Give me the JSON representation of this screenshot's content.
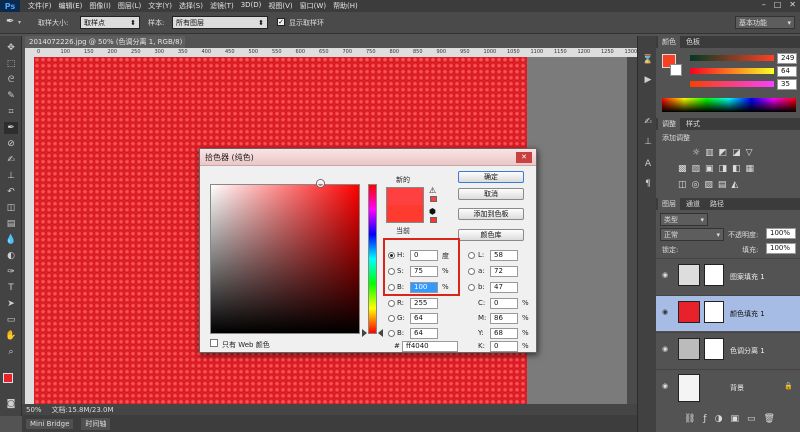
{
  "app": {
    "logo": "Ps"
  },
  "menubar": {
    "items": [
      "文件(F)",
      "编辑(E)",
      "图像(I)",
      "图层(L)",
      "文字(Y)",
      "选择(S)",
      "滤镜(T)",
      "3D(D)",
      "视图(V)",
      "窗口(W)",
      "帮助(H)"
    ],
    "window_controls": [
      "–",
      "□",
      "✕"
    ]
  },
  "options_bar": {
    "sample_size_label": "取样大小:",
    "sample_size_value": "取样点",
    "sample_label": "样本:",
    "sample_value": "所有图层",
    "show_ring_label": "显示取样环",
    "workspace_value": "基本功能"
  },
  "document": {
    "tab_title": "2014072226.jpg @ 50% (色调分离 1, RGB/8) * ×",
    "ruler_ticks": [
      "0",
      "100",
      "150",
      "200",
      "250",
      "300",
      "350",
      "400",
      "450",
      "500",
      "550",
      "600",
      "650",
      "700",
      "750",
      "800",
      "850",
      "900",
      "950",
      "1000",
      "1050",
      "1100",
      "1150",
      "1200",
      "1250",
      "1300"
    ]
  },
  "status_bar": {
    "zoom": "50%",
    "doc_info": "文档:15.8M/23.0M"
  },
  "bottom_tabs": [
    "Mini Bridge",
    "时间轴"
  ],
  "color_panel": {
    "tabs": [
      "颜色",
      "色板"
    ],
    "r_value": "249",
    "g_value": "64",
    "b_value": "35"
  },
  "adjustments_panel": {
    "tabs": [
      "调整",
      "样式"
    ],
    "hint": "添加调整"
  },
  "layers_panel": {
    "tabs": [
      "图层",
      "通道",
      "路径"
    ],
    "filter_kind": "类型",
    "blend_mode": "正常",
    "opacity_label": "不透明度:",
    "opacity_value": "100%",
    "lock_label": "锁定:",
    "fill_label": "填充:",
    "fill_value": "100%",
    "layers": [
      {
        "name": "图案填充 1",
        "selected": false
      },
      {
        "name": "颜色填充 1",
        "selected": true
      },
      {
        "name": "色调分离 1",
        "selected": false
      },
      {
        "name": "背景",
        "selected": false
      }
    ]
  },
  "color_picker": {
    "title": "拾色器 (纯色)",
    "new_label": "新的",
    "current_label": "当前",
    "ok_label": "确定",
    "cancel_label": "取消",
    "add_swatch_label": "添加到色板",
    "color_library_label": "颜色库",
    "web_only_label": "只有 Web 颜色",
    "new_color": "#ff4040",
    "current_color": "#ff3b2f",
    "fields": {
      "H": "0",
      "H_unit": "度",
      "S": "75",
      "S_unit": "%",
      "B": "100",
      "B_unit": "%",
      "R": "255",
      "G": "64",
      "Bb": "64",
      "L": "58",
      "a": "72",
      "b": "47",
      "C": "0",
      "M": "86",
      "Y": "68",
      "K": "0",
      "percent": "%",
      "hex": "ff4040"
    }
  }
}
